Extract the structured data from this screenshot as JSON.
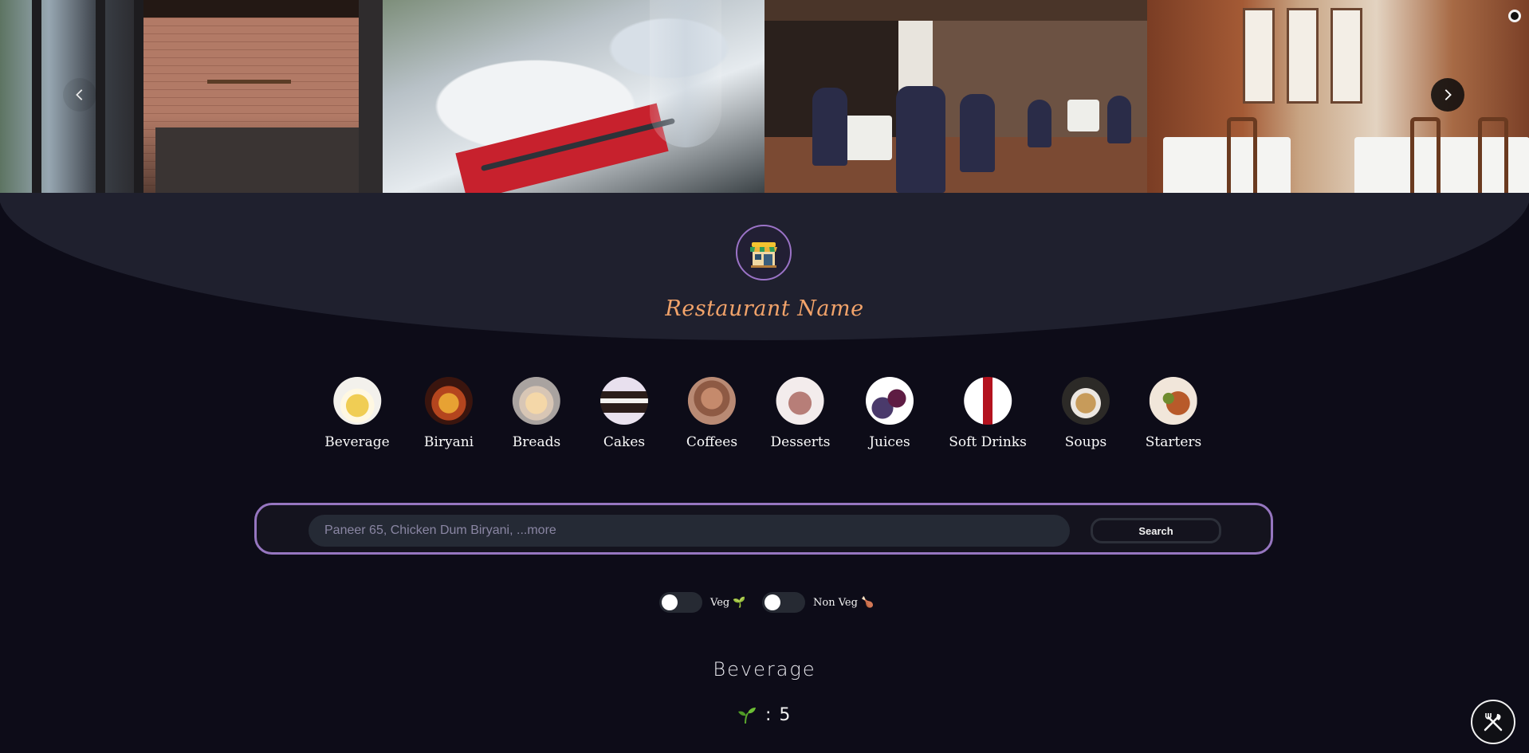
{
  "carousel": {
    "prev_icon": "chevron-left-icon",
    "next_icon": "chevron-right-icon"
  },
  "restaurant": {
    "logo_icon": "storefront-icon",
    "name": "Restaurant Name"
  },
  "categories": [
    {
      "label": "Beverage",
      "icon": "beverage-thumbnail"
    },
    {
      "label": "Biryani",
      "icon": "biryani-thumbnail"
    },
    {
      "label": "Breads",
      "icon": "breads-thumbnail"
    },
    {
      "label": "Cakes",
      "icon": "cakes-thumbnail"
    },
    {
      "label": "Coffees",
      "icon": "coffees-thumbnail"
    },
    {
      "label": "Desserts",
      "icon": "desserts-thumbnail"
    },
    {
      "label": "Juices",
      "icon": "juices-thumbnail"
    },
    {
      "label": "Soft Drinks",
      "icon": "soft-drinks-thumbnail"
    },
    {
      "label": "Soups",
      "icon": "soups-thumbnail"
    },
    {
      "label": "Starters",
      "icon": "starters-thumbnail"
    }
  ],
  "search": {
    "placeholder": "Paneer 65, Chicken Dum Biryani, ...more",
    "value": "",
    "button_label": "Search"
  },
  "filters": {
    "veg": {
      "label": "Veg 🌱",
      "on": false
    },
    "non_veg": {
      "label": "Non Veg 🍗",
      "on": false
    }
  },
  "section": {
    "title": "Beverage",
    "count_icon": "sprout-icon",
    "separator": ":",
    "count": "5"
  },
  "fab": {
    "icon": "fork-knife-icon"
  },
  "colors": {
    "accent": "#9676c0",
    "name": "#f2a36a",
    "background": "#0d0c18",
    "header": "#1f202e"
  }
}
